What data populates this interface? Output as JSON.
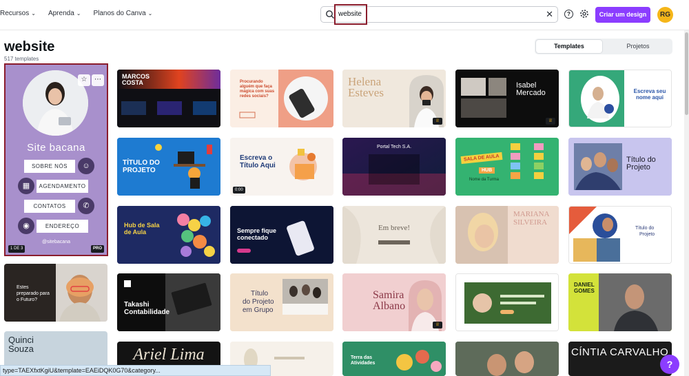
{
  "header": {
    "nav": [
      {
        "label": "Recursos"
      },
      {
        "label": "Aprenda"
      },
      {
        "label": "Planos do Canva"
      }
    ],
    "search": {
      "value": "website"
    },
    "help_label": "?",
    "create_label": "Criar um design",
    "avatar_initials": "RG",
    "colors": {
      "brand": "#8b3dff",
      "avatar": "#f5b619",
      "highlight": "#8a1c2c"
    }
  },
  "page": {
    "title": "website",
    "count": "517 templates",
    "segments": {
      "templates": "Templates",
      "projects": "Projetos"
    }
  },
  "featured": {
    "title": "Site bacana",
    "buttons": [
      "SOBRE NÓS",
      "AGENDAMENTO",
      "CONTATOS",
      "ENDEREÇO"
    ],
    "handle": "@sitebacana",
    "pager": "1 DE 3",
    "badge": "PRO"
  },
  "cards": {
    "marcos": {
      "line1": "MARCOS",
      "line2": "COSTA"
    },
    "procurando": {
      "text": "Procurando alguém que faça mágica com suas redes sociais?"
    },
    "helena": {
      "line1": "Helena",
      "line2": "Esteves"
    },
    "isabel": {
      "line1": "Isabel",
      "line2": "Mercado"
    },
    "escreva_nome": {
      "text": "Escreva seu nome aqui"
    },
    "titulo_projeto_blue": {
      "line1": "TÍTULO DO",
      "line2": "PROJETO"
    },
    "escreva_titulo": {
      "line1": "Escreva o",
      "line2": "Título Aqui",
      "duration": "0:00"
    },
    "portal": {
      "text": "Portal Tech S.A."
    },
    "sala": {
      "badge": "SALA DE AULA",
      "hub": "HUB",
      "sub": "Nome da Turma"
    },
    "titulo_projeto_lav": {
      "line1": "Título do",
      "line2": "Projeto"
    },
    "hub_sala": {
      "line1": "Hub de Sala",
      "line2": "de Aula"
    },
    "sempre": {
      "line1": "Sempre fique",
      "line2": "conectado"
    },
    "embreve": {
      "text": "Em breve!"
    },
    "mariana": {
      "line1": "MARIANA",
      "line2": "SILVEIRA"
    },
    "titulo_projeto_white": {
      "line1": "Título do",
      "line2": "Projeto"
    },
    "estes": {
      "text": "Estes preparado para o Futuro?"
    },
    "takashi": {
      "line1": "Takashi",
      "line2": "Contabilidade"
    },
    "titulo_grupo": {
      "line1": "Título",
      "line2": "do Projeto",
      "line3": "em Grupo"
    },
    "samira": {
      "line1": "Samira",
      "line2": "Albano"
    },
    "daniel": {
      "line1": "DANIEL",
      "line2": "GOMES"
    },
    "quinci": {
      "line1": "Quinci",
      "line2": "Souza"
    },
    "ariel": {
      "text": "Ariel Lima"
    },
    "terra": {
      "line1": "Terra das",
      "line2": "Atividades"
    },
    "cintia": {
      "text": "CÍNTIA CARVALHO"
    }
  },
  "statusbar": {
    "url": "type=TAEXfxtKgiU&template=EAEiDQK0G70&category..."
  },
  "fab_label": "?"
}
